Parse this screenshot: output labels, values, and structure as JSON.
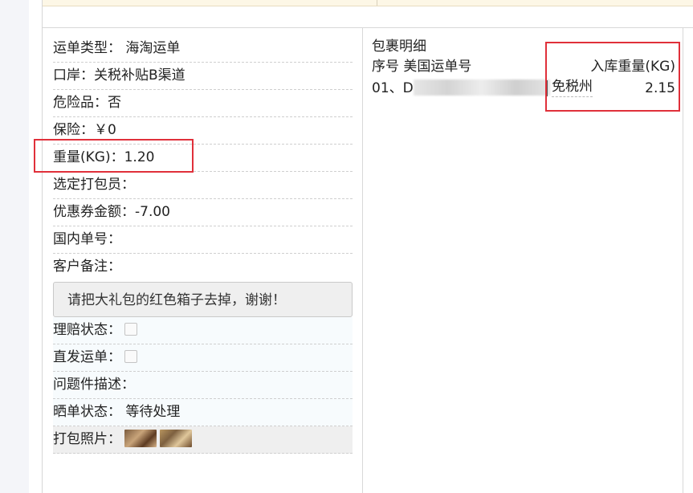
{
  "order_info": {
    "waybill_type": {
      "label": "运单类型：",
      "value": "海淘运单"
    },
    "port": {
      "label": "口岸：",
      "value": "关税补贴B渠道"
    },
    "dangerous": {
      "label": "危险品：",
      "value": "否"
    },
    "insurance": {
      "label": "保险：",
      "value": "￥0"
    },
    "weight": {
      "label": "重量(KG)：",
      "value": "1.20"
    },
    "packer": {
      "label": "选定打包员：",
      "value": ""
    },
    "coupon": {
      "label": "优惠券金额：",
      "value": "-7.00"
    },
    "domestic_no": {
      "label": "国内单号：",
      "value": ""
    },
    "customer_note": {
      "label": "客户备注：",
      "value": "请把大礼包的红色箱子去掉，谢谢！"
    },
    "claim_status": {
      "label": "理赔状态：",
      "checked": false
    },
    "direct_ship": {
      "label": "直发运单：",
      "checked": false
    },
    "problem_desc": {
      "label": "问题件描述：",
      "value": ""
    },
    "showcase_status": {
      "label": "晒单状态：",
      "value": "等待处理"
    },
    "pack_photos": {
      "label": "打包照片：",
      "count": 2
    }
  },
  "package_detail": {
    "title": "包裹明细",
    "col_index": "序号",
    "col_waybill": "美国运单号",
    "col_weight": "入库重量(KG)",
    "rows": [
      {
        "index": "01、D",
        "tax": "免税州",
        "weight": "2.15"
      }
    ]
  },
  "colors": {
    "highlight": "#e0303a",
    "top_band": "#fdf7e6"
  }
}
